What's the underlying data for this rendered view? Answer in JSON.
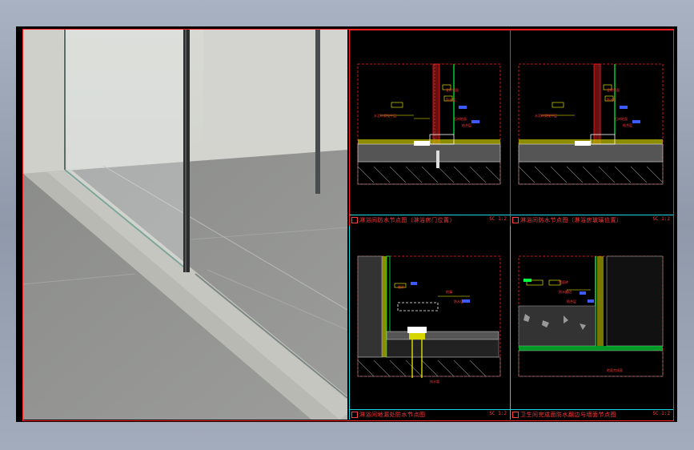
{
  "drawings": [
    {
      "title": "淋浴间防水节点图（淋浴房门位置）",
      "scale": "SC 1:2"
    },
    {
      "title": "淋浴间防水节点图（淋浴房玻璃位置）",
      "scale": "SC 1:2"
    },
    {
      "title": "淋浴间地漏处防水节点图",
      "scale": "SC 1:2"
    },
    {
      "title": "卫生间完成面防水翻边与墙面节点图",
      "scale": "SC 1:2"
    }
  ],
  "colors": {
    "background": "#000000",
    "frame": "#ff2020",
    "separator": "#17d6e0",
    "dimension": "#ffff00",
    "label": "#ff3b3b",
    "label_box": "#3b5bff",
    "waterproof": "#00ff40"
  }
}
